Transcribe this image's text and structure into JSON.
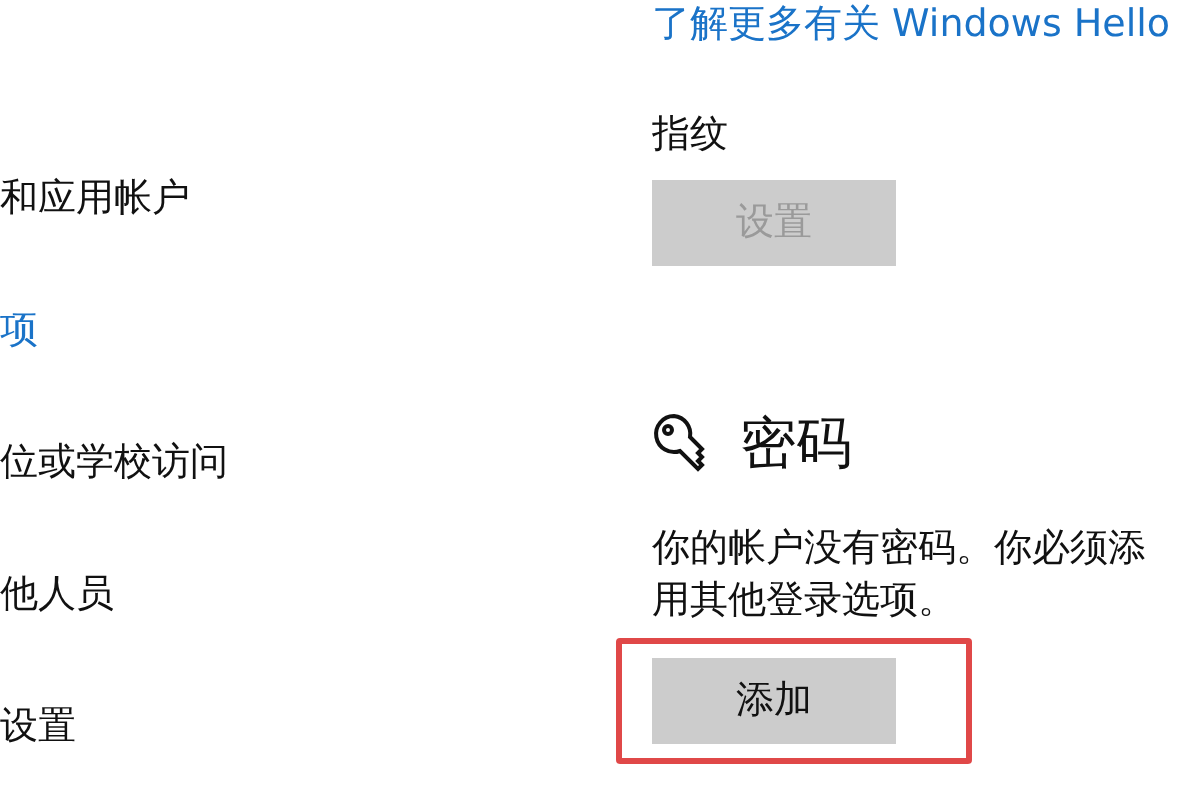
{
  "sidebar": {
    "items": [
      {
        "label": "和应用帐户",
        "selected": false
      },
      {
        "label": "项",
        "selected": true
      },
      {
        "label": "位或学校访问",
        "selected": false
      },
      {
        "label": "他人员",
        "selected": false
      },
      {
        "label": "设置",
        "selected": false
      }
    ]
  },
  "content": {
    "link": "了解更多有关 Windows Hello",
    "fingerprint": {
      "label": "指纹",
      "button": {
        "label": "设置",
        "disabled": true
      }
    },
    "password": {
      "title": "密码",
      "description_lines": [
        "你的帐户没有密码。你必须添",
        "用其他登录选项。"
      ],
      "button": {
        "label": "添加",
        "disabled": false,
        "highlighted": true
      }
    }
  }
}
